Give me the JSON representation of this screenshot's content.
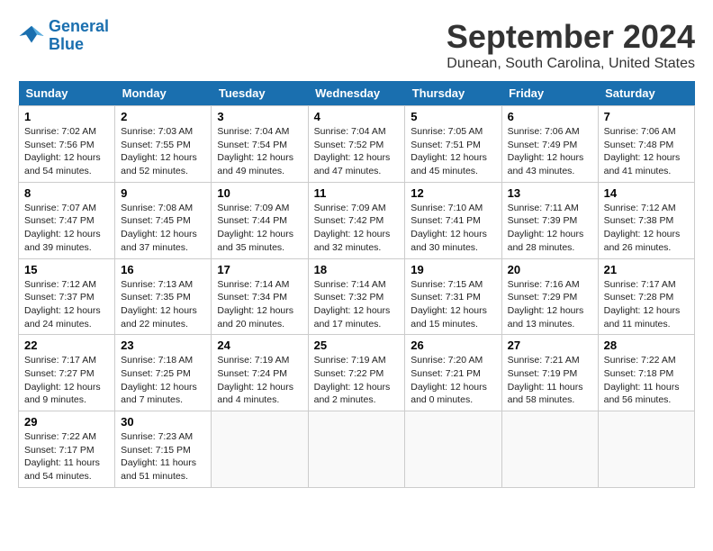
{
  "header": {
    "logo_line1": "General",
    "logo_line2": "Blue",
    "month_year": "September 2024",
    "location": "Dunean, South Carolina, United States"
  },
  "days_of_week": [
    "Sunday",
    "Monday",
    "Tuesday",
    "Wednesday",
    "Thursday",
    "Friday",
    "Saturday"
  ],
  "weeks": [
    [
      {
        "day": "1",
        "sunrise": "7:02 AM",
        "sunset": "7:56 PM",
        "daylight": "12 hours and 54 minutes."
      },
      {
        "day": "2",
        "sunrise": "7:03 AM",
        "sunset": "7:55 PM",
        "daylight": "12 hours and 52 minutes."
      },
      {
        "day": "3",
        "sunrise": "7:04 AM",
        "sunset": "7:54 PM",
        "daylight": "12 hours and 49 minutes."
      },
      {
        "day": "4",
        "sunrise": "7:04 AM",
        "sunset": "7:52 PM",
        "daylight": "12 hours and 47 minutes."
      },
      {
        "day": "5",
        "sunrise": "7:05 AM",
        "sunset": "7:51 PM",
        "daylight": "12 hours and 45 minutes."
      },
      {
        "day": "6",
        "sunrise": "7:06 AM",
        "sunset": "7:49 PM",
        "daylight": "12 hours and 43 minutes."
      },
      {
        "day": "7",
        "sunrise": "7:06 AM",
        "sunset": "7:48 PM",
        "daylight": "12 hours and 41 minutes."
      }
    ],
    [
      {
        "day": "8",
        "sunrise": "7:07 AM",
        "sunset": "7:47 PM",
        "daylight": "12 hours and 39 minutes."
      },
      {
        "day": "9",
        "sunrise": "7:08 AM",
        "sunset": "7:45 PM",
        "daylight": "12 hours and 37 minutes."
      },
      {
        "day": "10",
        "sunrise": "7:09 AM",
        "sunset": "7:44 PM",
        "daylight": "12 hours and 35 minutes."
      },
      {
        "day": "11",
        "sunrise": "7:09 AM",
        "sunset": "7:42 PM",
        "daylight": "12 hours and 32 minutes."
      },
      {
        "day": "12",
        "sunrise": "7:10 AM",
        "sunset": "7:41 PM",
        "daylight": "12 hours and 30 minutes."
      },
      {
        "day": "13",
        "sunrise": "7:11 AM",
        "sunset": "7:39 PM",
        "daylight": "12 hours and 28 minutes."
      },
      {
        "day": "14",
        "sunrise": "7:12 AM",
        "sunset": "7:38 PM",
        "daylight": "12 hours and 26 minutes."
      }
    ],
    [
      {
        "day": "15",
        "sunrise": "7:12 AM",
        "sunset": "7:37 PM",
        "daylight": "12 hours and 24 minutes."
      },
      {
        "day": "16",
        "sunrise": "7:13 AM",
        "sunset": "7:35 PM",
        "daylight": "12 hours and 22 minutes."
      },
      {
        "day": "17",
        "sunrise": "7:14 AM",
        "sunset": "7:34 PM",
        "daylight": "12 hours and 20 minutes."
      },
      {
        "day": "18",
        "sunrise": "7:14 AM",
        "sunset": "7:32 PM",
        "daylight": "12 hours and 17 minutes."
      },
      {
        "day": "19",
        "sunrise": "7:15 AM",
        "sunset": "7:31 PM",
        "daylight": "12 hours and 15 minutes."
      },
      {
        "day": "20",
        "sunrise": "7:16 AM",
        "sunset": "7:29 PM",
        "daylight": "12 hours and 13 minutes."
      },
      {
        "day": "21",
        "sunrise": "7:17 AM",
        "sunset": "7:28 PM",
        "daylight": "12 hours and 11 minutes."
      }
    ],
    [
      {
        "day": "22",
        "sunrise": "7:17 AM",
        "sunset": "7:27 PM",
        "daylight": "12 hours and 9 minutes."
      },
      {
        "day": "23",
        "sunrise": "7:18 AM",
        "sunset": "7:25 PM",
        "daylight": "12 hours and 7 minutes."
      },
      {
        "day": "24",
        "sunrise": "7:19 AM",
        "sunset": "7:24 PM",
        "daylight": "12 hours and 4 minutes."
      },
      {
        "day": "25",
        "sunrise": "7:19 AM",
        "sunset": "7:22 PM",
        "daylight": "12 hours and 2 minutes."
      },
      {
        "day": "26",
        "sunrise": "7:20 AM",
        "sunset": "7:21 PM",
        "daylight": "12 hours and 0 minutes."
      },
      {
        "day": "27",
        "sunrise": "7:21 AM",
        "sunset": "7:19 PM",
        "daylight": "11 hours and 58 minutes."
      },
      {
        "day": "28",
        "sunrise": "7:22 AM",
        "sunset": "7:18 PM",
        "daylight": "11 hours and 56 minutes."
      }
    ],
    [
      {
        "day": "29",
        "sunrise": "7:22 AM",
        "sunset": "7:17 PM",
        "daylight": "11 hours and 54 minutes."
      },
      {
        "day": "30",
        "sunrise": "7:23 AM",
        "sunset": "7:15 PM",
        "daylight": "11 hours and 51 minutes."
      },
      null,
      null,
      null,
      null,
      null
    ]
  ]
}
